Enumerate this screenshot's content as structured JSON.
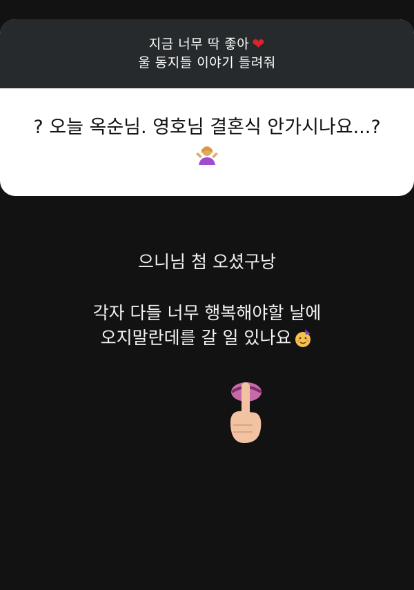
{
  "story": {
    "question_header_line1": "지금 너무 딱 좋아",
    "question_header_line2": "울 동지들 이야기 들려줘",
    "answer_text": "? 오늘 옥순님. 영호님 결혼식 안가시나요...?",
    "reply_line1": "으니님 첨 오셨구낭",
    "reply_line2": "각자 다들 너무 행복해야할 날에",
    "reply_line3": "오지말란데를 갈 일 있나요",
    "icons": [
      "heart-icon",
      "person-shrugging-icon",
      "face-with-party-hat-icon",
      "shushing-finger-icon"
    ],
    "colors": {
      "background": "#121212",
      "header": "#262a2c",
      "answer_bg": "#ffffff",
      "heart": "#e0202a"
    }
  }
}
